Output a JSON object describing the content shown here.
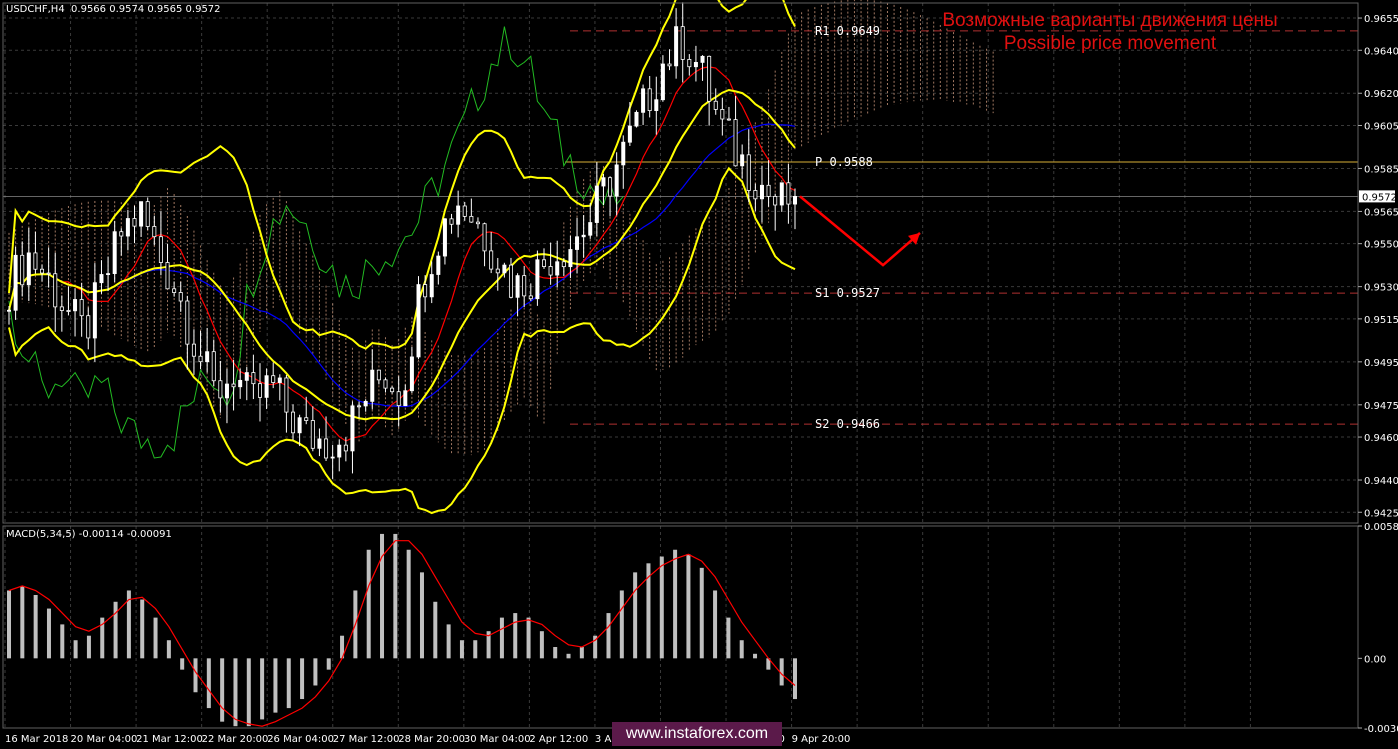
{
  "main_header": "USDCHF,H4  0.9566 0.9574 0.9565 0.9572",
  "macd_header": "MACD(5,34,5) -0.00114 -0.00091",
  "caption": {
    "line1": "Возможные варианты движения цены",
    "line2": "Possible price movement"
  },
  "watermark": "www.instaforex.com",
  "current_price": "0.9572",
  "colors": {
    "background": "#000000",
    "grid": "#3a3a3a",
    "bull_candle": "#ffffff",
    "bear_candle": "#000000",
    "bollinger": "#ffff00",
    "tenkan": "#ff0000",
    "kijun": "#0000ff",
    "chikou": "#22bb22",
    "cloud": "#c8957a",
    "pivot": "#d8b038",
    "support_resistance": "#b03030",
    "arrow": "#ff0000",
    "macd_hist": "#c0c0c0",
    "macd_signal": "#ff0000"
  },
  "chart_data": [
    {
      "type": "candlestick",
      "symbol": "USDCHF",
      "timeframe": "H4",
      "ylim": [
        0.942,
        0.9662
      ],
      "y_ticks": [
        "0.9655",
        "0.9640",
        "0.9620",
        "0.9605",
        "0.9585",
        "0.9565",
        "0.9550",
        "0.9530",
        "0.9515",
        "0.9495",
        "0.9475",
        "0.9460",
        "0.9440",
        "0.9425"
      ],
      "x_ticks": [
        "16 Mar 2018",
        "20 Mar 04:00",
        "21 Mar 12:00",
        "22 Mar 20:00",
        "26 Mar 04:00",
        "27 Mar 12:00",
        "28 Mar 20:00",
        "30 Mar 04:00",
        "2 Apr 12:00",
        "3 Apr 20:00",
        "5 Apr 04:00",
        "6 Apr 12:00",
        "9 Apr 20:00"
      ],
      "levels": [
        {
          "label": "R1 0.9649",
          "value": 0.9649
        },
        {
          "label": "P 0.9588",
          "value": 0.9588
        },
        {
          "label": "S1 0.9527",
          "value": 0.9527
        },
        {
          "label": "S2 0.9466",
          "value": 0.9466
        }
      ],
      "last_price": 0.9572,
      "close_path": [
        0.953,
        0.9545,
        0.9535,
        0.952,
        0.9508,
        0.953,
        0.9555,
        0.9565,
        0.9545,
        0.9528,
        0.9502,
        0.948,
        0.949,
        0.9475,
        0.9485,
        0.947,
        0.946,
        0.9458,
        0.9462,
        0.9478,
        0.949,
        0.948,
        0.953,
        0.9555,
        0.957,
        0.956,
        0.9545,
        0.953,
        0.9535,
        0.9545,
        0.955,
        0.956,
        0.9578,
        0.9595,
        0.9615,
        0.9635,
        0.9645,
        0.963,
        0.9605,
        0.959,
        0.958,
        0.9568,
        0.9572
      ],
      "forecast_path": [
        0.9572,
        0.954,
        0.9555
      ]
    },
    {
      "type": "bar",
      "name": "MACD(5,34,5)",
      "values_label": [
        "-0.00114",
        "-0.00091"
      ],
      "ylim": [
        -0.00308,
        0.00585
      ],
      "y_ticks": [
        "0.00585",
        "0.00",
        "-0.00308"
      ],
      "histogram": [
        0.003,
        0.0032,
        0.0028,
        0.0022,
        0.0015,
        0.0008,
        0.001,
        0.0018,
        0.0025,
        0.003,
        0.0026,
        0.0018,
        0.0008,
        -0.0005,
        -0.0015,
        -0.0022,
        -0.0028,
        -0.003,
        -0.003,
        -0.0027,
        -0.0024,
        -0.0022,
        -0.0018,
        -0.0012,
        -0.0005,
        0.001,
        0.003,
        0.0048,
        0.0055,
        0.0055,
        0.0048,
        0.0038,
        0.0025,
        0.0015,
        0.0008,
        0.0008,
        0.0012,
        0.0018,
        0.002,
        0.0018,
        0.0012,
        0.0005,
        0.0002,
        0.0005,
        0.001,
        0.002,
        0.003,
        0.0038,
        0.0042,
        0.0045,
        0.0048,
        0.0046,
        0.004,
        0.003,
        0.0018,
        0.0008,
        0.0002,
        -0.0005,
        -0.0012,
        -0.0018
      ],
      "signal": [
        0.003,
        0.0032,
        0.003,
        0.0026,
        0.002,
        0.0014,
        0.0012,
        0.0015,
        0.002,
        0.0026,
        0.0027,
        0.0022,
        0.0014,
        0.0004,
        -0.0006,
        -0.0014,
        -0.0022,
        -0.0027,
        -0.0029,
        -0.003,
        -0.0028,
        -0.0025,
        -0.0022,
        -0.0017,
        -0.001,
        0.0,
        0.0015,
        0.0032,
        0.0045,
        0.0052,
        0.0052,
        0.0046,
        0.0036,
        0.0026,
        0.0016,
        0.0011,
        0.001,
        0.0013,
        0.0016,
        0.0017,
        0.0015,
        0.001,
        0.0006,
        0.0005,
        0.0008,
        0.0014,
        0.0022,
        0.003,
        0.0036,
        0.0041,
        0.0044,
        0.0046,
        0.0043,
        0.0036,
        0.0026,
        0.0016,
        0.0008,
        0.0,
        -0.0007,
        -0.0012
      ]
    }
  ]
}
